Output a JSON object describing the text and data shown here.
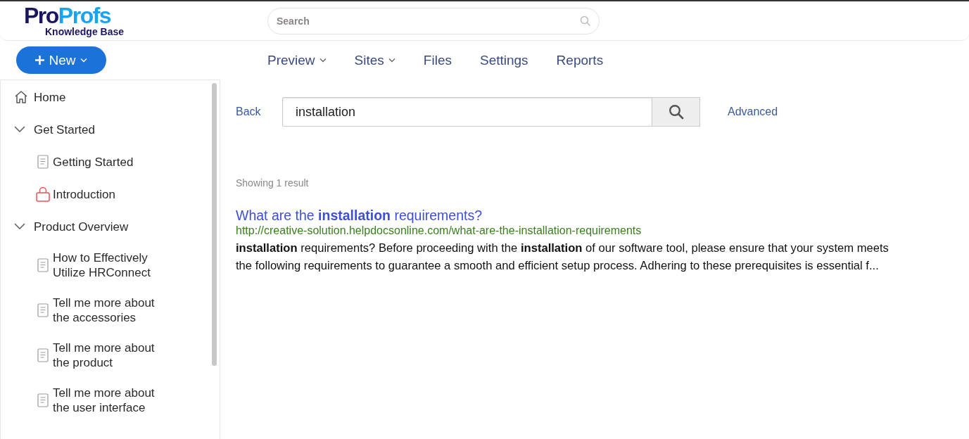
{
  "logo": {
    "part_1": "Pro",
    "part_2": "Profs",
    "subtitle": "Knowledge Base"
  },
  "header_search": {
    "placeholder": "Search"
  },
  "new_button": {
    "label": "New"
  },
  "nav": [
    {
      "label": "Preview",
      "has_dropdown": true
    },
    {
      "label": "Sites",
      "has_dropdown": true
    },
    {
      "label": "Files",
      "has_dropdown": false
    },
    {
      "label": "Settings",
      "has_dropdown": false
    },
    {
      "label": "Reports",
      "has_dropdown": false
    }
  ],
  "sidebar": {
    "items": [
      {
        "kind": "home",
        "label": "Home"
      },
      {
        "kind": "folder",
        "label": "Get Started",
        "expanded": true,
        "children": [
          {
            "kind": "article",
            "label": "Getting Started"
          },
          {
            "kind": "locked",
            "label": "Introduction"
          }
        ]
      },
      {
        "kind": "folder",
        "label": "Product Overview",
        "expanded": true,
        "children": [
          {
            "kind": "article",
            "label": "How to Effectively Utilize HRConnect"
          },
          {
            "kind": "article",
            "label": "Tell me more about the accessories"
          },
          {
            "kind": "article",
            "label": "Tell me more about the product"
          },
          {
            "kind": "article",
            "label": "Tell me more about the user interface"
          }
        ]
      }
    ]
  },
  "search": {
    "back": "Back",
    "value": "installation",
    "advanced": "Advanced"
  },
  "results_count": "Showing 1 result",
  "results": [
    {
      "title": "What are the **installation** requirements?",
      "url": "http://creative-solution.helpdocsonline.com/what-are-the-installation-requirements",
      "snippet": "**installation** requirements? Before proceeding with the **installation** of our software tool, please ensure that your system meets the following requirements to guarantee a smooth and efficient setup process. Adhering to these prerequisites is essential f..."
    }
  ]
}
